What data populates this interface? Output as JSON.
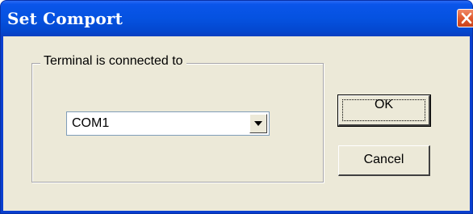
{
  "window": {
    "title": "Set Comport",
    "close_icon": "close-icon"
  },
  "group": {
    "label": "Terminal is connected to"
  },
  "port_select": {
    "selected": "COM1",
    "arrow_icon": "chevron-down-icon"
  },
  "buttons": {
    "ok_label": "OK",
    "cancel_label": "Cancel"
  },
  "colors": {
    "titlebar": "#0552e0",
    "client": "#ece9d8",
    "close_button": "#e05a2e"
  }
}
